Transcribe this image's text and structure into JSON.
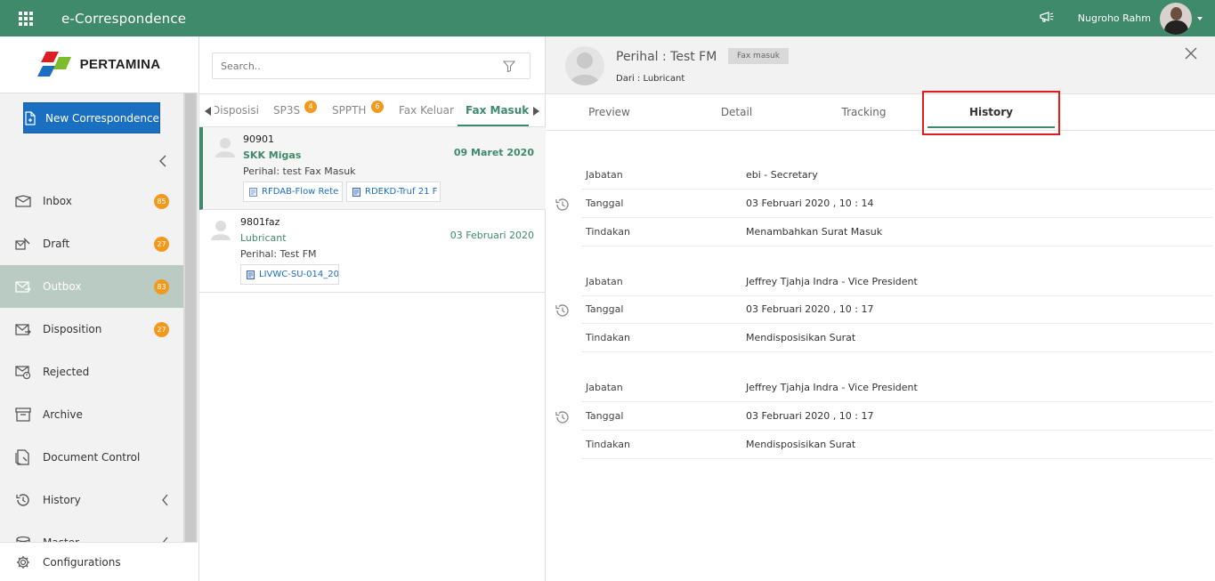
{
  "topbar": {
    "app_title": "e-Correspondence",
    "user_name": "Nugroho Rahm",
    "accent_color": "#3f8a6b"
  },
  "sidebar": {
    "logo_text": "PERTAMINA",
    "new_button_label": "New Correspondence",
    "items": [
      {
        "label": "Inbox",
        "badge": "85",
        "icon": "inbox-icon"
      },
      {
        "label": "Draft",
        "badge": "27",
        "icon": "draft-icon"
      },
      {
        "label": "Outbox",
        "badge": "83",
        "icon": "outbox-icon",
        "active": true
      },
      {
        "label": "Disposition",
        "badge": "27",
        "icon": "disposition-icon"
      },
      {
        "label": "Rejected",
        "icon": "rejected-icon"
      },
      {
        "label": "Archive",
        "icon": "archive-icon"
      },
      {
        "label": "Document Control",
        "icon": "document-control-icon"
      },
      {
        "label": "History",
        "icon": "history-icon"
      },
      {
        "label": "Master",
        "icon": "master-icon"
      }
    ],
    "config_label": "Configurations"
  },
  "list": {
    "search_placeholder": "Search..",
    "tabs": [
      {
        "label": "Disposisi"
      },
      {
        "label": "SP3S",
        "badge": "4"
      },
      {
        "label": "SPPTH",
        "badge": "6"
      },
      {
        "label": "Fax Keluar"
      },
      {
        "label": "Fax Masuk",
        "active": true
      }
    ],
    "messages": [
      {
        "id": "90901",
        "sender": "SKK Migas",
        "date": "09 Maret 2020",
        "subject": "Perihal: test Fax Masuk",
        "attachments": [
          "RFDAB-Flow Rete",
          "RDEKD-Truf 21 F"
        ]
      },
      {
        "id": "9801faz",
        "sender": "Lubricant",
        "date": "03 Februari 2020",
        "subject": "Perihal: Test FM",
        "attachments": [
          "LIVWC-SU-014_20"
        ]
      }
    ]
  },
  "detail": {
    "title": "Perihal : Test FM",
    "type_chip": "Fax masuk",
    "from": "Dari : Lubricant",
    "tabs": [
      "Preview",
      "Detail",
      "Tracking",
      "History"
    ],
    "active_tab": "History",
    "history": [
      {
        "jabatan_label": "Jabatan",
        "jabatan": "ebi - Secretary",
        "tanggal_label": "Tanggal",
        "tanggal": "03 Februari 2020 , 10 : 14",
        "tindakan_label": "Tindakan",
        "tindakan": "Menambahkan Surat Masuk"
      },
      {
        "jabatan_label": "Jabatan",
        "jabatan": "Jeffrey Tjahja Indra - Vice President",
        "tanggal_label": "Tanggal",
        "tanggal": "03 Februari 2020 , 10 : 17",
        "tindakan_label": "Tindakan",
        "tindakan": "Mendisposisikan Surat"
      },
      {
        "jabatan_label": "Jabatan",
        "jabatan": "Jeffrey Tjahja Indra - Vice President",
        "tanggal_label": "Tanggal",
        "tanggal": "03 Februari 2020 , 10 : 17",
        "tindakan_label": "Tindakan",
        "tindakan": "Mendisposisikan Surat"
      }
    ]
  }
}
